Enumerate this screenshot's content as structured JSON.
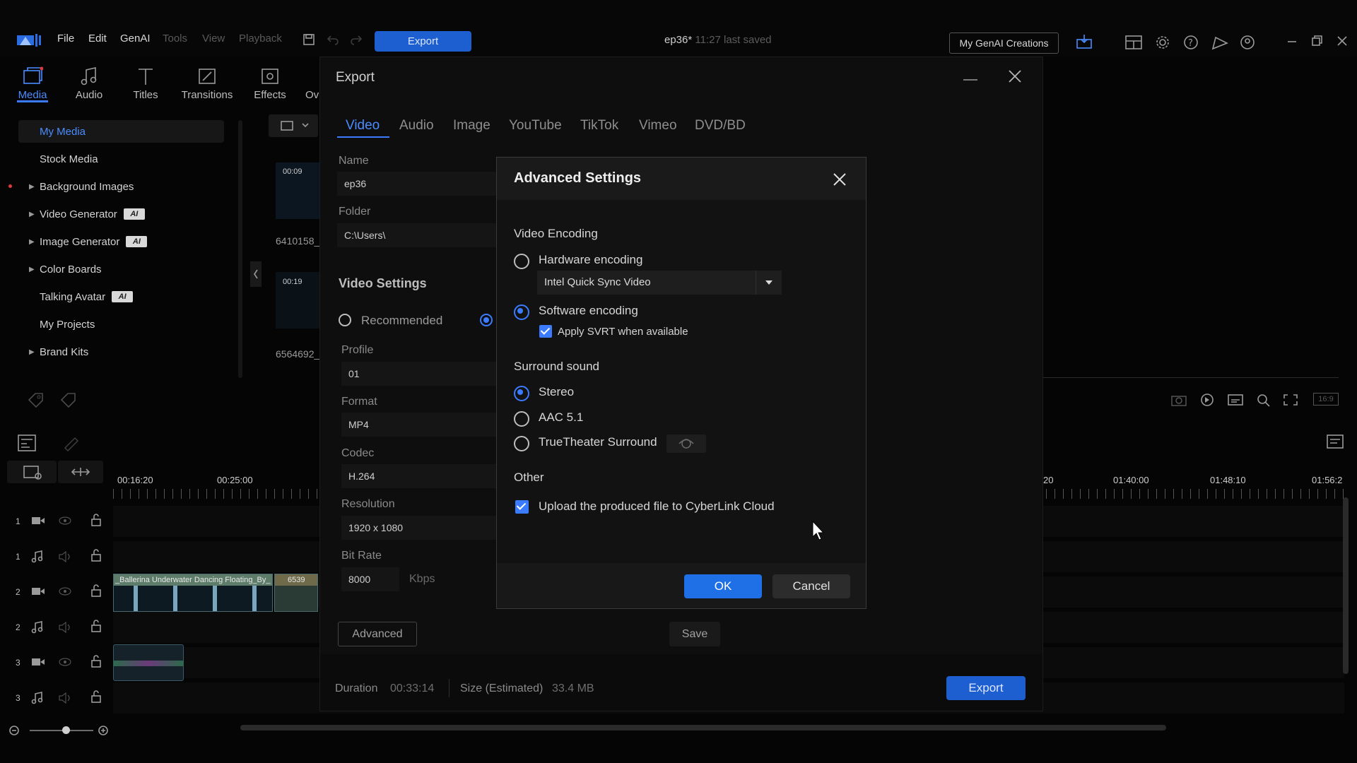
{
  "menu": {
    "file": "File",
    "edit": "Edit",
    "genai": "GenAI",
    "tools": "Tools",
    "view": "View",
    "playback": "Playback",
    "export_button": "Export",
    "project_name": "ep36*",
    "last_saved": "11:27 last saved",
    "genai_creations": "My GenAI Creations"
  },
  "rooms": {
    "media": "Media",
    "audio": "Audio",
    "titles": "Titles",
    "transitions": "Transitions",
    "effects": "Effects",
    "overflow": "Ov"
  },
  "library_tree": {
    "my_media": "My Media",
    "stock_media": "Stock Media",
    "background_images": "Background Images",
    "video_generator": "Video Generator",
    "image_generator": "Image Generator",
    "color_boards": "Color Boards",
    "talking_avatar": "Talking Avatar",
    "my_projects": "My Projects",
    "brand_kits": "Brand Kits",
    "ai_badge": "AI"
  },
  "media_thumbs": {
    "thumb1_duration": "00:09",
    "thumb1_name": "6410158_",
    "thumb2_duration": "00:19",
    "thumb2_name": "6564692_"
  },
  "timeline": {
    "ruler_left": [
      "00:16:20",
      "00:25:00"
    ],
    "ruler_right": [
      "20",
      "01:40:00",
      "01:48:10",
      "01:56:2"
    ],
    "tracks": [
      "1",
      "1",
      "2",
      "2",
      "3",
      "3"
    ],
    "clip1_label": "_Ballerina Underwater Dancing Floating_By_",
    "clip2_label": "6539"
  },
  "preview": {
    "aspect": "16:9"
  },
  "export_window": {
    "title": "Export",
    "tabs": [
      "Video",
      "Audio",
      "Image",
      "YouTube",
      "TikTok",
      "Vimeo",
      "DVD/BD"
    ],
    "name_label": "Name",
    "name_value": "ep36",
    "folder_label": "Folder",
    "folder_value": "C:\\Users\\",
    "video_settings": "Video Settings",
    "recommended": "Recommended",
    "profile_label": "Profile",
    "profile_value": "01",
    "format_label": "Format",
    "format_value": "MP4",
    "codec_label": "Codec",
    "codec_value": "H.264",
    "resolution_label": "Resolution",
    "resolution_value": "1920 x 1080",
    "bitrate_label": "Bit Rate",
    "bitrate_value": "8000",
    "bitrate_unit": "Kbps",
    "advanced_button": "Advanced",
    "save_button": "Save",
    "duration_label": "Duration",
    "duration_value": "00:33:14",
    "size_label": "Size (Estimated)",
    "size_value": "33.4 MB",
    "export_button": "Export"
  },
  "advanced_settings": {
    "title": "Advanced Settings",
    "video_encoding": "Video Encoding",
    "hardware_encoding": "Hardware encoding",
    "hardware_select": "Intel Quick Sync Video",
    "software_encoding": "Software encoding",
    "apply_svrt": "Apply SVRT when available",
    "surround_sound": "Surround sound",
    "stereo": "Stereo",
    "aac51": "AAC 5.1",
    "truetheater": "TrueTheater Surround",
    "other": "Other",
    "upload_cloud": "Upload the produced file to CyberLink Cloud",
    "ok": "OK",
    "cancel": "Cancel"
  },
  "colors": {
    "accent": "#3b7bff",
    "background": "#050505",
    "dialog": "#121212"
  }
}
